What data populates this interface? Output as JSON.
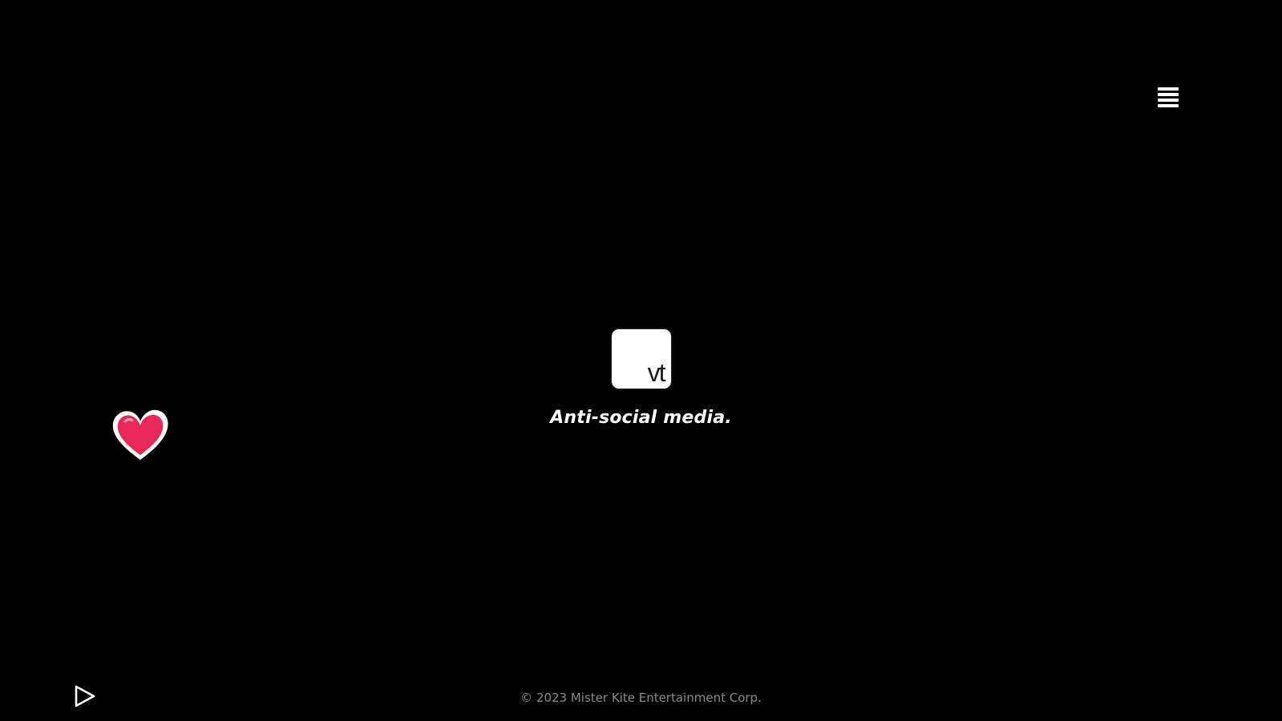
{
  "header": {
    "menu_icon": "hamburger-menu-icon"
  },
  "brand": {
    "logo_text": "vt",
    "tagline": "Anti-social media."
  },
  "decor": {
    "heart_icon": "heart-icon",
    "heart_color": "#e8275a",
    "heart_outline": "#ffffff"
  },
  "controls": {
    "play_icon": "play-icon"
  },
  "footer": {
    "copyright": "© 2023 Mister Kite Entertainment Corp."
  },
  "colors": {
    "background": "#000000",
    "text": "#ffffff",
    "muted_text": "#8a8a8a"
  }
}
